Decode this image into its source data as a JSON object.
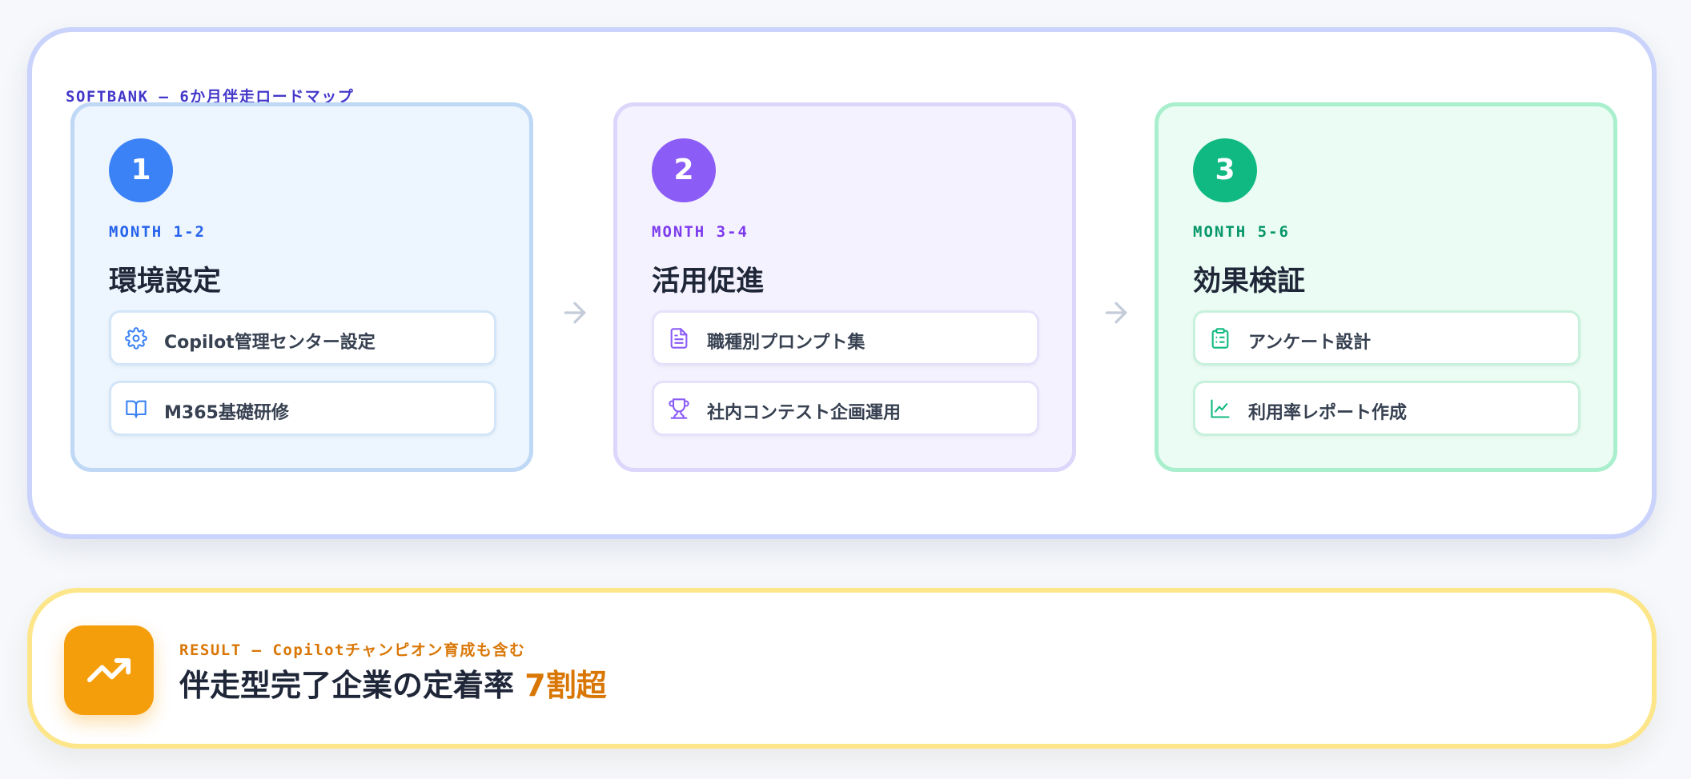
{
  "colors": {
    "phase_1_accent": "#3b82f6",
    "phase_1_month": "#2563eb",
    "phase_2_accent": "#8b5cf6",
    "phase_2_month": "#7c3aed",
    "phase_3_accent": "#10b981",
    "phase_3_month": "#059669",
    "result_accent": "#f59e0b",
    "result_text_accent": "#d97706",
    "heading_eyebrow": "#4338ca",
    "arrow": "#c3ccd8"
  },
  "roadmap": {
    "eyebrow": "SOFTBANK – 6か月伴走ロードマップ",
    "phases": [
      {
        "number": "1",
        "month": "MONTH 1-2",
        "title": "環境設定",
        "tasks": [
          {
            "icon": "gear-icon",
            "label": "Copilot管理センター設定"
          },
          {
            "icon": "book-open-icon",
            "label": "M365基礎研修"
          }
        ]
      },
      {
        "number": "2",
        "month": "MONTH 3-4",
        "title": "活用促進",
        "tasks": [
          {
            "icon": "document-icon",
            "label": "職種別プロンプト集"
          },
          {
            "icon": "trophy-icon",
            "label": "社内コンテスト企画運用"
          }
        ]
      },
      {
        "number": "3",
        "month": "MONTH 5-6",
        "title": "効果検証",
        "tasks": [
          {
            "icon": "clipboard-list-icon",
            "label": "アンケート設計"
          },
          {
            "icon": "line-chart-icon",
            "label": "利用率レポート作成"
          }
        ]
      }
    ],
    "arrow_icon": "arrow-right-icon"
  },
  "result": {
    "icon": "trending-up-icon",
    "eyebrow": "RESULT – Copilotチャンピオン育成も含む",
    "headline": "伴走型完了企業の定着率",
    "highlight": "7割超"
  }
}
